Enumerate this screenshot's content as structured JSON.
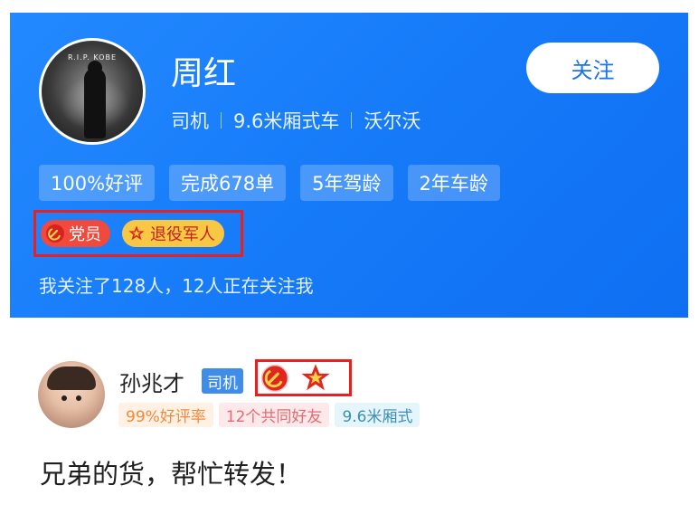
{
  "profile": {
    "avatar_caption": "R.I.P. KOBE",
    "name": "周红",
    "follow_label": "关注",
    "meta": [
      "司机",
      "9.6米厢式车",
      "沃尔沃"
    ],
    "stats": [
      "100%好评",
      "完成678单",
      "5年驾龄",
      "2年车龄"
    ],
    "badges": [
      {
        "label": "党员",
        "icon": "party-emblem-icon",
        "color": "#f0493d"
      },
      {
        "label": "退役军人",
        "icon": "star-emblem-icon",
        "color": "#f8c844"
      }
    ],
    "follow_summary": "我关注了128人，12人正在关注我"
  },
  "post": {
    "author": "孙兆才",
    "role": "司机",
    "icons": [
      "party-emblem-icon",
      "star-emblem-icon"
    ],
    "tags": [
      "99%好评率",
      "12个共同好友",
      "9.6米厢式"
    ],
    "text": "兄弟的货，帮忙转发！"
  },
  "colors": {
    "header_blue": "#1a7ff5",
    "highlight_red": "#ea1f1f",
    "party_red": "#f0493d",
    "veteran_yellow": "#f8c844"
  }
}
